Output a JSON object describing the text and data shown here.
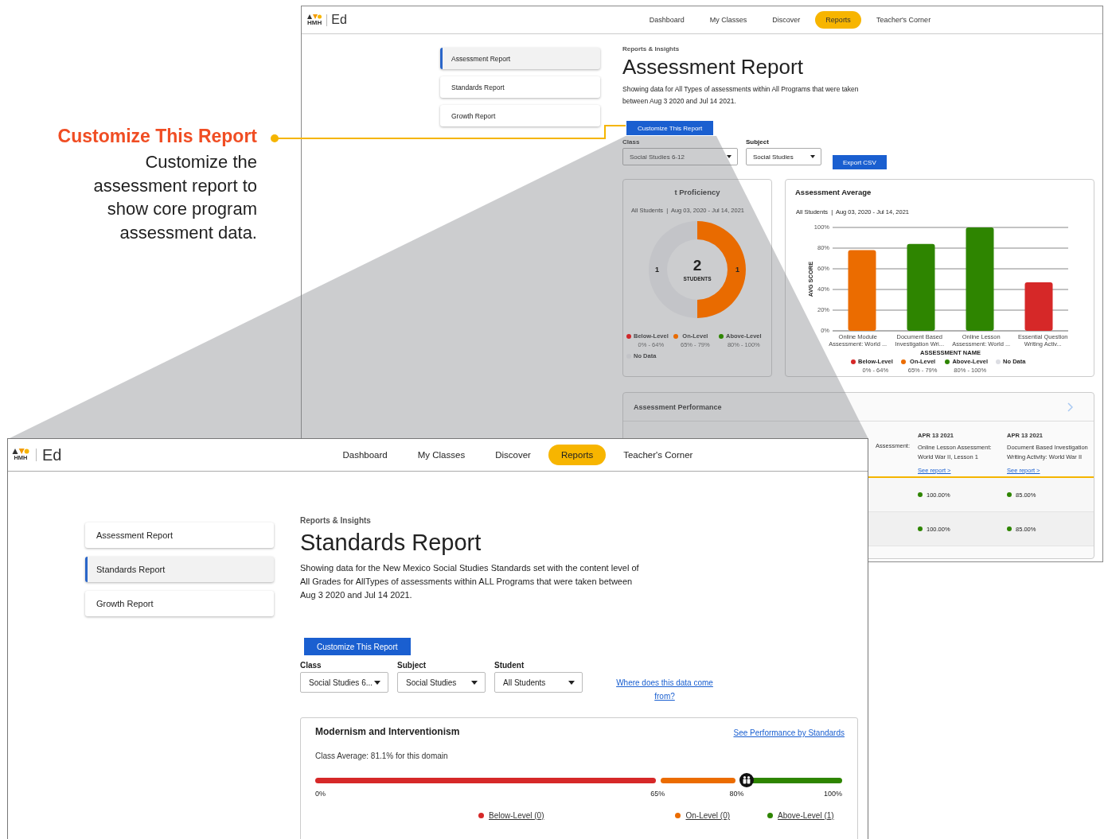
{
  "callout": {
    "title": "Customize This Report",
    "description": "Customize the assessment report to show core program assessment data."
  },
  "back_window": {
    "logo": {
      "brand": "HMH",
      "product": "Ed"
    },
    "nav": [
      {
        "label": "Dashboard",
        "selected": false
      },
      {
        "label": "My Classes",
        "selected": false
      },
      {
        "label": "Discover",
        "selected": false
      },
      {
        "label": "Reports",
        "selected": true
      },
      {
        "label": "Teacher's Corner",
        "selected": false
      }
    ],
    "sidebar": [
      {
        "label": "Assessment Report",
        "selected": true
      },
      {
        "label": "Standards Report",
        "selected": false
      },
      {
        "label": "Growth Report",
        "selected": false
      }
    ],
    "breadcrumb": "Reports & Insights",
    "title": "Assessment Report",
    "description": "Showing data for All Types of assessments within All Programs that were taken between Aug 3 2020 and Jul 14 2021.",
    "customize_button": "Customize This Report",
    "filters": [
      {
        "label": "Class",
        "value": "Social Studies 6-12"
      },
      {
        "label": "Subject",
        "value": "Social Studies"
      }
    ],
    "export_button": "Export CSV",
    "proficiency_card": {
      "title": "t Proficiency",
      "subtitle": "All Students  |  Aug 03, 2020 - Jul 14, 2021",
      "center_value": "2",
      "center_label": "STUDENTS",
      "chart_data": {
        "type": "donut",
        "categories": [
          "Below-Level",
          "On-Level",
          "Above-Level",
          "No Data"
        ],
        "values": [
          0,
          1,
          0,
          1
        ],
        "data_labels": true
      },
      "legend": [
        {
          "range": "0% - 64%",
          "color": "#d0272a"
        },
        {
          "range": "65% - 79%",
          "color": "#e96b00"
        },
        {
          "range": "80% - 100%",
          "color": "#2e8500"
        },
        {
          "color": "#c3c4c8"
        }
      ]
    },
    "average_card": {
      "title": "Assessment Average",
      "subtitle": "All Students  |  Aug 03, 2020 - Jul 14, 2021",
      "chart_data": {
        "type": "bar",
        "xlabel": "ASSESSMENT NAME",
        "ylabel": "AVG SCORE",
        "grid": true,
        "categories": [
          "Online Module Assessment: World ...",
          "Document Based Investigation Wri...",
          "Online Lesson Assessment: World ...",
          "Essential Question Writing Activ..."
        ],
        "series": [
          {
            "name": "Below-Level",
            "color": "#d62828",
            "values": [
              null,
              null,
              null,
              47
            ]
          },
          {
            "name": "On-Level",
            "color": "#eb6c00",
            "values": [
              78,
              null,
              null,
              null
            ]
          },
          {
            "name": "Above-Level",
            "color": "#2e8500",
            "values": [
              null,
              84,
              100,
              null
            ]
          },
          {
            "name": "No Data",
            "color": "#dcdde3",
            "values": [
              null,
              null,
              null,
              null
            ]
          }
        ],
        "ylim": [
          0,
          100
        ],
        "yticks": [
          {
            "value": 0,
            "label": "0%"
          },
          {
            "value": 20,
            "label": "20%"
          },
          {
            "value": 40,
            "label": "40%"
          },
          {
            "value": 60,
            "label": "60%"
          },
          {
            "value": 80,
            "label": "80%"
          },
          {
            "value": 100,
            "label": "100%"
          }
        ]
      },
      "legend_ranges": [
        "0% - 64%",
        "65% - 79%",
        "80% - 100%"
      ]
    },
    "performance_card": {
      "title": "Assessment Performance",
      "columns": [
        {
          "name": "Assessment:"
        },
        {
          "date": "APR 13 2021",
          "name": "Online Lesson Assessment: World War II, Lesson 1",
          "link": "See report >"
        },
        {
          "date": "APR 13 2021",
          "name": "Document Based Investigation Writing Activity: World War II",
          "link": "See report >"
        }
      ],
      "rows": [
        {
          "scores": [
            {
              "value": "100.00%",
              "color": "#2e8500"
            },
            {
              "value": "85.00%",
              "color": "#2e8500"
            }
          ]
        },
        {
          "scores": [
            {
              "value": "100.00%",
              "color": "#2e8500"
            },
            {
              "value": "85.00%",
              "color": "#2e8500"
            }
          ]
        }
      ]
    }
  },
  "front_window": {
    "logo": {
      "brand": "HMH",
      "product": "Ed"
    },
    "nav": [
      {
        "label": "Dashboard",
        "selected": false
      },
      {
        "label": "My Classes",
        "selected": false
      },
      {
        "label": "Discover",
        "selected": false
      },
      {
        "label": "Reports",
        "selected": true
      },
      {
        "label": "Teacher's Corner",
        "selected": false
      }
    ],
    "sidebar": [
      {
        "label": "Assessment Report",
        "selected": false
      },
      {
        "label": "Standards Report",
        "selected": true
      },
      {
        "label": "Growth Report",
        "selected": false
      }
    ],
    "breadcrumb": "Reports & Insights",
    "title": "Standards Report",
    "description": "Showing data for the New Mexico Social Studies Standards set with the content level of All Grades for AllTypes of assessments within ALL Programs that were taken between Aug 3 2020 and Jul 14 2021.",
    "customize_button": "Customize This Report",
    "filters": [
      {
        "label": "Class",
        "value": "Social Studies 6..."
      },
      {
        "label": "Subject",
        "value": "Social Studies"
      },
      {
        "label": "Student",
        "value": "All Students"
      }
    ],
    "data_link": "Where does this data come from?",
    "domain_card": {
      "title": "Modernism and Interventionism",
      "link": "See Performance by Standards",
      "average": "Class Average: 81.1% for this domain",
      "segments": [
        {
          "color": "#d62828"
        },
        {
          "color": "#eb6c00"
        },
        {
          "color": "#2e8500"
        }
      ],
      "marker": {
        "level": 0.811
      },
      "ticks": [
        {
          "label": "0%"
        },
        {
          "label": "65%"
        },
        {
          "label": "80%"
        },
        {
          "label": "100%"
        }
      ],
      "legend": [
        {
          "label": "Below-Level (0)",
          "color": "#d62828"
        },
        {
          "label": "On-Level (0)",
          "color": "#eb6c00"
        },
        {
          "label": "Above-Level (1)",
          "color": "#2e8500"
        }
      ]
    }
  }
}
